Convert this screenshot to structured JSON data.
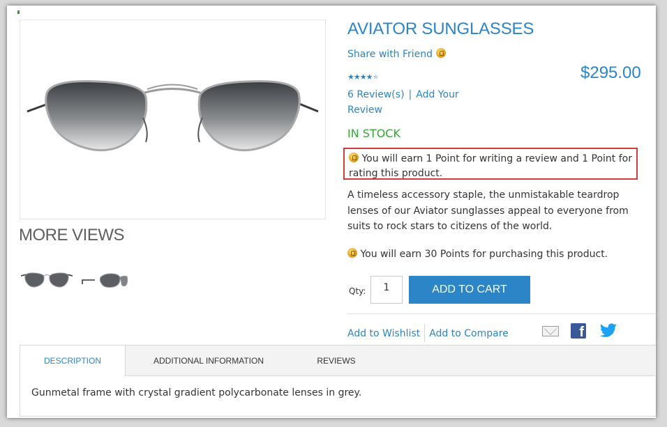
{
  "product": {
    "title": "AVIATOR SUNGLASSES",
    "share_label": "Share with Friend",
    "price": "$295.00",
    "rating_stars": "★★★★",
    "rating_half": "★",
    "rating_value": 4.5,
    "reviews_label": "6 Review(s)",
    "review_separator": "|",
    "add_review_label": "Add Your Review",
    "stock": "IN STOCK",
    "earn_review_text": "You will earn 1 Point for writing a review and 1 Point for rating this product.",
    "short_description": "A timeless accessory staple, the unmistakable teardrop lenses of our Aviator sunglasses appeal to everyone from suits to rock stars to citizens of the world.",
    "earn_purchase_text": "You will earn 30 Points for purchasing this product."
  },
  "gallery": {
    "more_views_label": "MORE VIEWS"
  },
  "cart": {
    "qty_label": "Qty:",
    "qty_value": "1",
    "add_to_cart_label": "ADD TO CART"
  },
  "links": {
    "wishlist": "Add to Wishlist",
    "compare": "Add to Compare"
  },
  "tabs": {
    "items": [
      "DESCRIPTION",
      "ADDITIONAL INFORMATION",
      "REVIEWS"
    ],
    "active": "DESCRIPTION",
    "content": "Gunmetal frame with crystal gradient polycarbonate lenses in grey."
  },
  "icons": {
    "points": "reward-points-icon",
    "mail": "mail-icon",
    "facebook": "facebook-icon",
    "twitter": "twitter-icon"
  },
  "colors": {
    "accent": "#2b85c7",
    "stock": "#36a636",
    "highlight_border": "#cc3c3c"
  }
}
